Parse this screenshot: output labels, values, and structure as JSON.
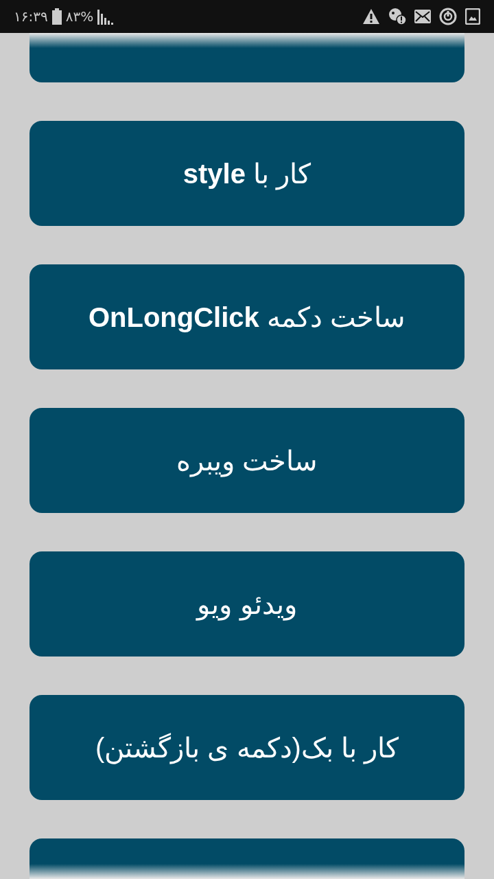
{
  "status_bar": {
    "time": "۱۶:۳۹",
    "battery": "۸۳%"
  },
  "buttons": [
    {
      "kind": "clipped"
    },
    {
      "kind": "full",
      "label": "کار با **style**"
    },
    {
      "kind": "full",
      "label": "ساخت دکمه **OnLongClick**"
    },
    {
      "kind": "full",
      "label": "ساخت ویبره"
    },
    {
      "kind": "full",
      "label": "ویدئو ویو"
    },
    {
      "kind": "full",
      "label": "کار با بک(دکمه ی بازگشتن)"
    },
    {
      "kind": "clipped"
    }
  ]
}
